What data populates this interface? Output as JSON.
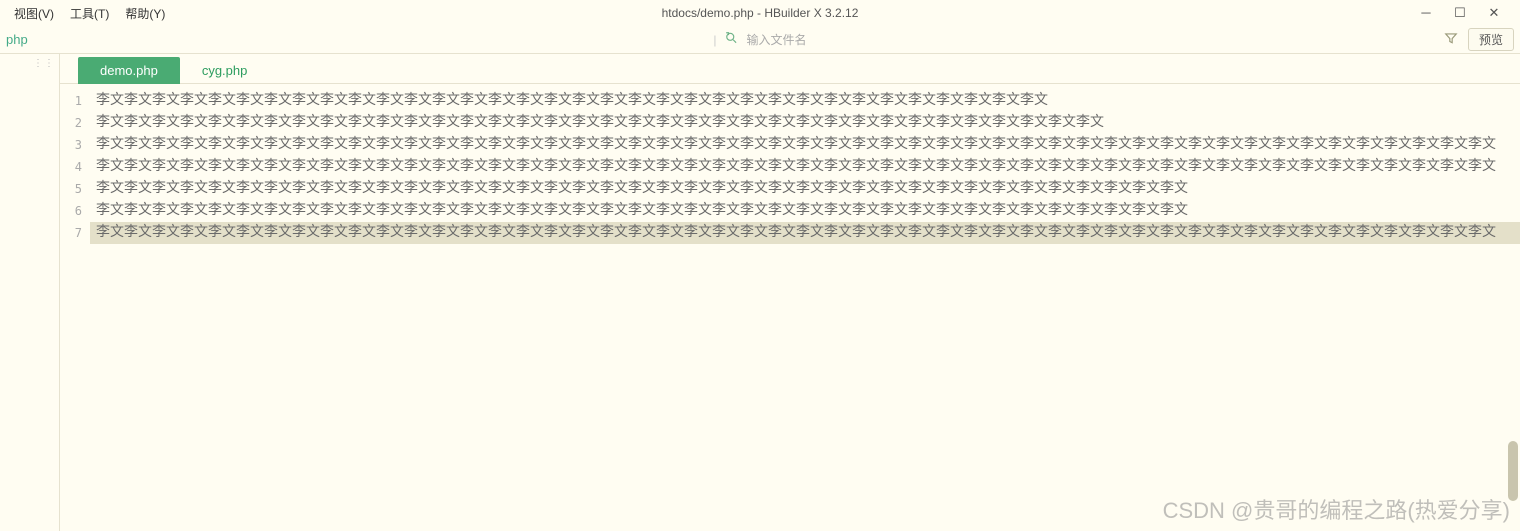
{
  "menu": {
    "view": "视图(V)",
    "tools": "工具(T)",
    "help": "帮助(Y)"
  },
  "window": {
    "title": "htdocs/demo.php - HBuilder X 3.2.12"
  },
  "toolbar": {
    "crumb": "php",
    "search_placeholder": "输入文件名",
    "preview_label": "预览"
  },
  "tabs": [
    {
      "label": "demo.php",
      "active": true
    },
    {
      "label": "cyg.php",
      "active": false
    }
  ],
  "editor": {
    "lines": [
      "李文李文李文李文李文李文李文李文李文李文李文李文李文李文李文李文李文李文李文李文李文李文李文李文李文李文李文李文李文李文李文李文李文李文",
      "李文李文李文李文李文李文李文李文李文李文李文李文李文李文李文李文李文李文李文李文李文李文李文李文李文李文李文李文李文李文李文李文李文李文李文李文",
      "李文李文李文李文李文李文李文李文李文李文李文李文李文李文李文李文李文李文李文李文李文李文李文李文李文李文李文李文李文李文李文李文李文李文李文李文李文李文李文李文李文李文李文李文李文李文李文李文李文李文",
      "李文李文李文李文李文李文李文李文李文李文李文李文李文李文李文李文李文李文李文李文李文李文李文李文李文李文李文李文李文李文李文李文李文李文李文李文李文李文李文李文李文李文李文李文李文李文李文李文李文李文",
      "李文李文李文李文李文李文李文李文李文李文李文李文李文李文李文李文李文李文李文李文李文李文李文李文李文李文李文李文李文李文李文李文李文李文李文李文李文李文李文",
      "李文李文李文李文李文李文李文李文李文李文李文李文李文李文李文李文李文李文李文李文李文李文李文李文李文李文李文李文李文李文李文李文李文李文李文李文李文李文李文",
      "李文李文李文李文李文李文李文李文李文李文李文李文李文李文李文李文李文李文李文李文李文李文李文李文李文李文李文李文李文李文李文李文李文李文李文李文李文李文李文李文李文李文李文李文李文李文李文李文李文李文"
    ],
    "selected_line_index": 6
  },
  "watermark": "CSDN @贵哥的编程之路(热爱分享)"
}
